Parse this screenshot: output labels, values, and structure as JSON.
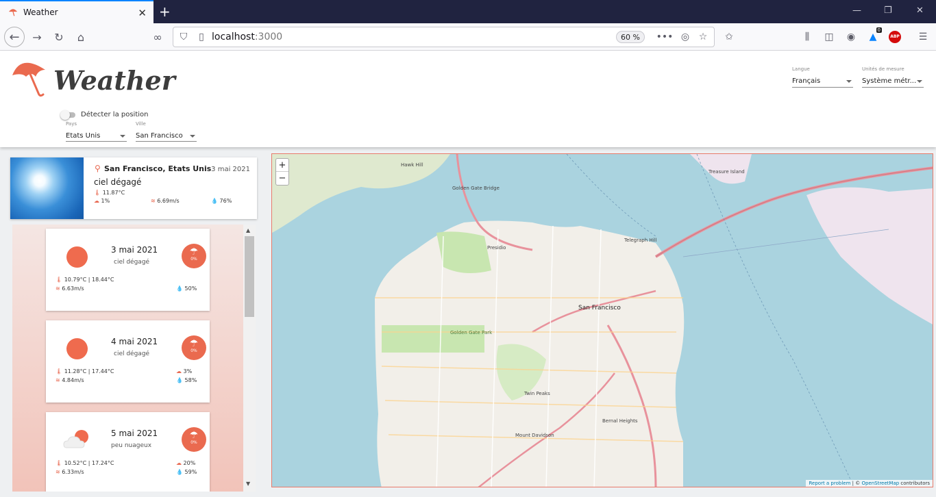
{
  "browser": {
    "tab_title": "Weather",
    "url_host": "localhost",
    "url_port": ":3000",
    "zoom": "60 %",
    "notification_count": "0",
    "abp_label": "ABP"
  },
  "app": {
    "title": "Weather",
    "language": {
      "label": "Langue",
      "value": "Français"
    },
    "units": {
      "label": "Unités de mesure",
      "value": "Système métr..."
    },
    "detect_position_label": "Détecter la position",
    "country": {
      "label": "Pays",
      "value": "Etats Unis"
    },
    "city": {
      "label": "Ville",
      "value": "San Francisco"
    }
  },
  "current": {
    "location": "San Francisco, Etats Unis",
    "date": "3 mai 2021",
    "description": "ciel dégagé",
    "temperature": "11.87°C",
    "precipitation": "1%",
    "wind": "6.69m/s",
    "humidity": "76%"
  },
  "forecast": [
    {
      "date": "3 mai 2021",
      "description": "ciel dégagé",
      "temps": "10.79°C | 18.44°C",
      "wind": "6.63m/s",
      "rain": "",
      "humidity": "50%",
      "badge": "0%",
      "icon": "sun-icon"
    },
    {
      "date": "4 mai 2021",
      "description": "ciel dégagé",
      "temps": "11.28°C | 17.44°C",
      "wind": "4.84m/s",
      "rain": "3%",
      "humidity": "58%",
      "badge": "0%",
      "icon": "sun-icon"
    },
    {
      "date": "5 mai 2021",
      "description": "peu nuageux",
      "temps": "10.52°C | 17.24°C",
      "wind": "6.33m/s",
      "rain": "20%",
      "humidity": "59%",
      "badge": "0%",
      "icon": "partly-cloudy-icon"
    }
  ],
  "map": {
    "zoom_in": "+",
    "zoom_out": "−",
    "attribution_link": "Report a problem",
    "attribution_sep": " | © ",
    "attribution_osm": "OpenStreetMap",
    "attribution_tail": " contributors",
    "labels": {
      "golden_gate": "Golden Gate Bridge",
      "presidio": "Presidio",
      "sf": "San Francisco",
      "golden_gate_park": "Golden Gate Park",
      "telegraph": "Telegraph Hill",
      "twin_peaks": "Twin Peaks",
      "mount_davidson": "Mount Davidson",
      "bernal": "Bernal Heights",
      "treasure": "Treasure Island",
      "hawk": "Hawk Hill"
    }
  },
  "colors": {
    "accent": "#ea6a4f",
    "map_water": "#aad3df",
    "map_land": "#f2efe9"
  }
}
